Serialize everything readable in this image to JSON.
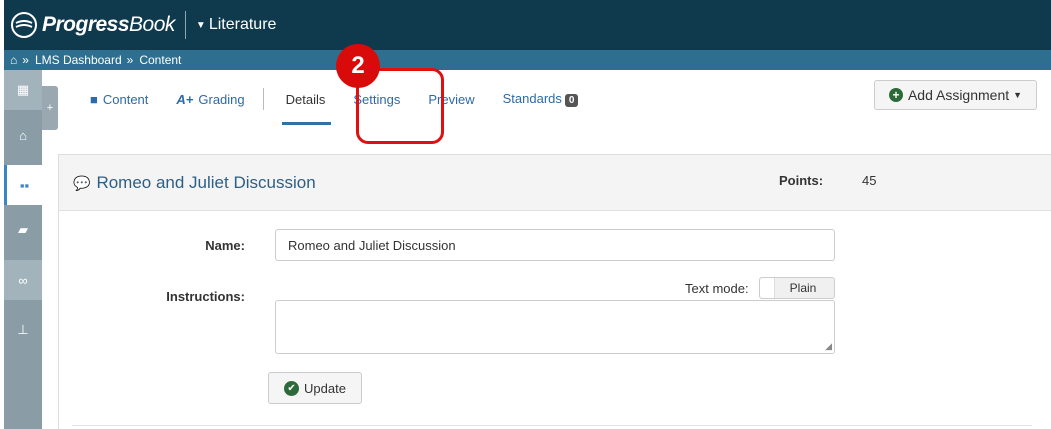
{
  "header": {
    "logo_bold": "Progress",
    "logo_rest": "Book",
    "course": "Literature"
  },
  "breadcrumb": {
    "items": [
      "LMS Dashboard",
      "Content"
    ]
  },
  "sidebar": {
    "items": [
      {
        "icon": "calendar-icon",
        "glyph": "▦"
      },
      {
        "icon": "home-icon",
        "glyph": "⌂"
      },
      {
        "icon": "dashboard-grid-icon",
        "glyph": "▪"
      },
      {
        "icon": "book-icon",
        "glyph": "▰"
      },
      {
        "icon": "link-icon",
        "glyph": "∞"
      },
      {
        "icon": "sitemap-icon",
        "glyph": "⊥"
      }
    ]
  },
  "tabs": {
    "content": "Content",
    "grading": "Grading",
    "details": "Details",
    "settings": "Settings",
    "preview": "Preview",
    "standards": "Standards",
    "standards_count": "0"
  },
  "toolbar": {
    "add_assignment": "Add Assignment"
  },
  "callout": {
    "step": "2"
  },
  "assignment": {
    "title": "Romeo and Juliet Discussion",
    "points_label": "Points:",
    "points_value": "45"
  },
  "form": {
    "name_label": "Name:",
    "name_value": "Romeo and Juliet Discussion",
    "instructions_label": "Instructions:",
    "text_mode_label": "Text mode:",
    "text_mode_value": "Plain",
    "instructions_value": "",
    "update_label": "Update"
  },
  "colors": {
    "topbar": "#0f3a4e",
    "breadcrumb": "#2e6f8f",
    "sidebar": "#8a9da6",
    "callout": "#e01010",
    "link": "#2d6aa6"
  }
}
